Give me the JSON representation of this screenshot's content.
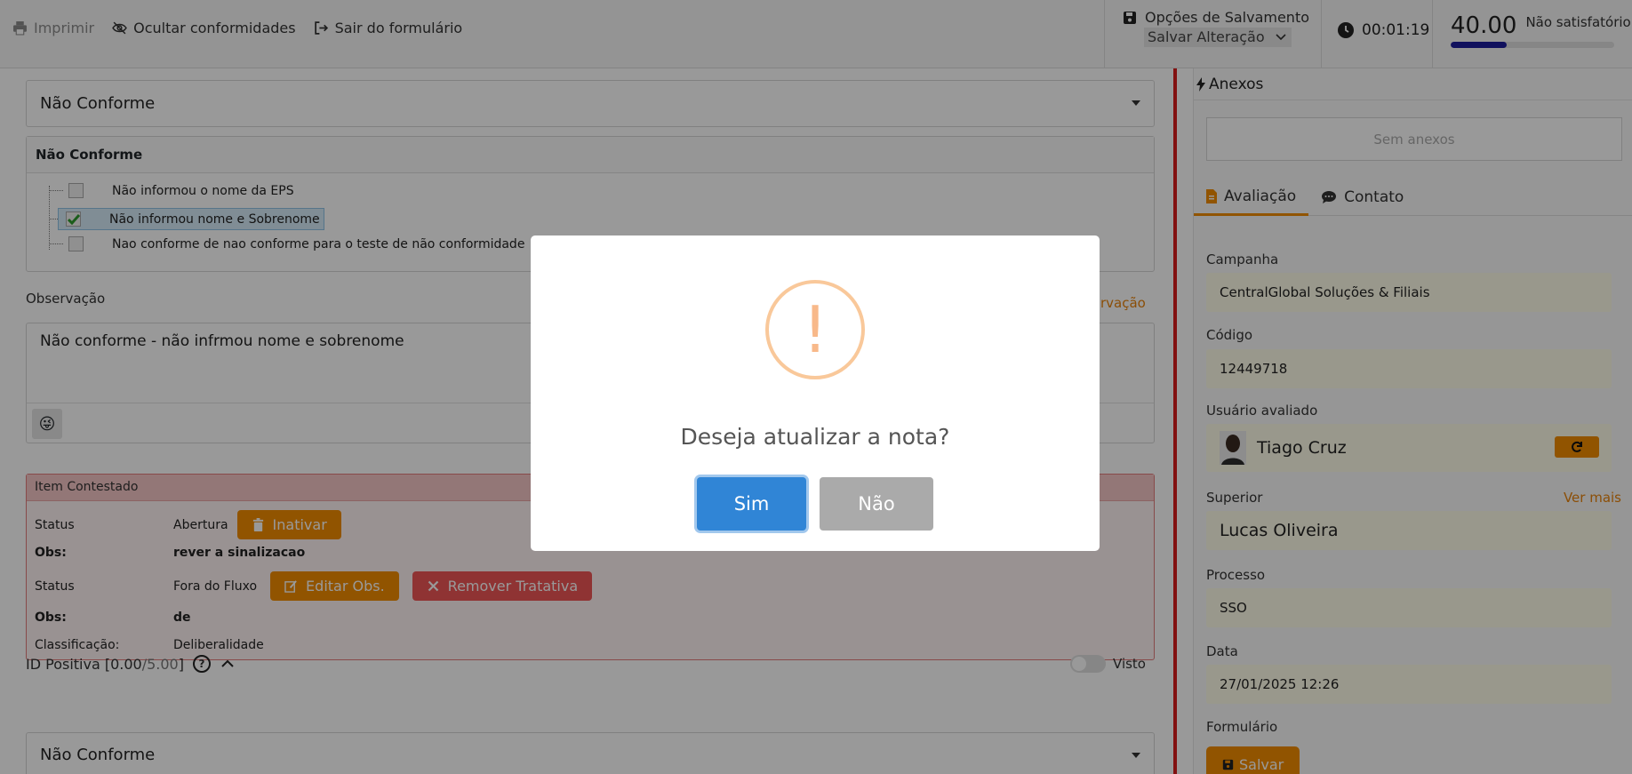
{
  "topbar": {
    "print_label": "Imprimir",
    "hide_label": "Ocultar conformidades",
    "exit_label": "Sair do formulário",
    "save_options_title": "Opções de Salvamento",
    "save_mode_value": "Salvar Alteração",
    "timer": "00:01:19",
    "score": "40.00",
    "score_label": "Não satisfatório",
    "score_progress": 0.34
  },
  "main": {
    "dropdown1_value": "Não Conforme",
    "tree_title": "Não Conforme",
    "tree_items": [
      {
        "label": "Não informou o nome da EPS",
        "checked": false
      },
      {
        "label": "Não informou nome e Sobrenome",
        "checked": true
      },
      {
        "label": "Nao conforme de nao conforme para o teste de não conformidade",
        "checked": false
      }
    ],
    "obs_label": "Observação",
    "obs_link": "rvação",
    "obs_text": "Não conforme - não infrmou nome e sobrenome",
    "contest": {
      "title": "Item Contestado",
      "status_key": "Status",
      "obs_key": "Obs:",
      "class_key": "Classificação:",
      "status1": "Abertura",
      "inativar_label": "Inativar",
      "obs1": "rever a sinalizacao",
      "status2": "Fora do Fluxo",
      "editar_label": "Editar Obs.",
      "remover_label": "Remover Tratativa",
      "obs2": "de",
      "classificacao": "Deliberalidade"
    },
    "idpos": {
      "label": "ID Positiva [",
      "score": "0.00",
      "sep": "/",
      "max": "5.00",
      "close": "]",
      "visto_label": "Visto"
    },
    "dropdown2_value": "Não Conforme"
  },
  "sidebar": {
    "anexos_title": "Anexos",
    "sem_anexos": "Sem anexos",
    "tab_avaliacao": "Avaliação",
    "tab_contato": "Contato",
    "campanha_label": "Campanha",
    "campanha_value": "CentralGlobal Soluções & Filiais",
    "codigo_label": "Código",
    "codigo_value": "12449718",
    "usuario_label": "Usuário avaliado",
    "usuario_value": "Tiago Cruz",
    "superior_label": "Superior",
    "ver_mais": "Ver mais",
    "superior_value": "Lucas Oliveira",
    "processo_label": "Processo",
    "processo_value": "SSO",
    "data_label": "Data",
    "data_value": "27/01/2025 12:26",
    "formulario_label": "Formulário",
    "salvar_label": "Salvar"
  },
  "modal": {
    "icon": "!",
    "title": "Deseja atualizar a nota?",
    "yes_label": "Sim",
    "no_label": "Não"
  },
  "colors": {
    "accent_orange": "#f28c00",
    "danger_red": "#d91c1c",
    "primary_blue": "#3085d6",
    "score_bar": "#1c1c9c"
  }
}
